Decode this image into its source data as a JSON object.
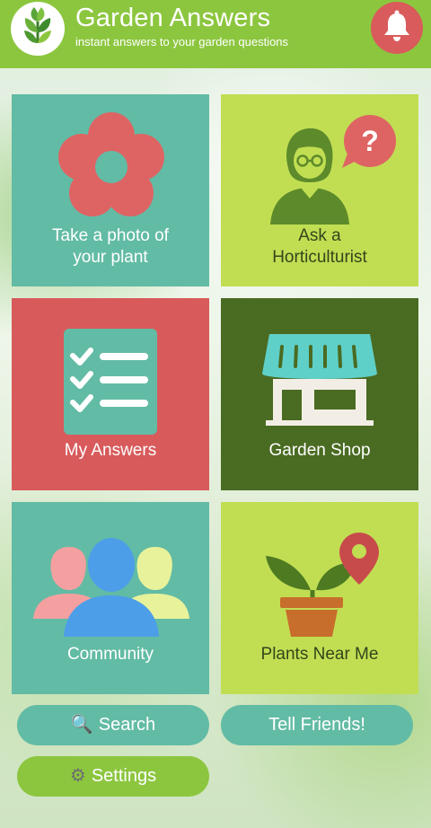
{
  "header": {
    "title": "Garden Answers",
    "subtitle": "instant answers to your garden questions",
    "logo_icon": "seedling-logo-icon",
    "notification_icon": "bell-icon"
  },
  "tiles": [
    {
      "label": "Take a photo of your plant",
      "lines": [
        "Take a photo of",
        "your plant"
      ],
      "icon": "flower-icon",
      "color": "#62bba5"
    },
    {
      "label": "Ask a Horticulturist",
      "lines": [
        "Ask a",
        "Horticulturist"
      ],
      "icon": "person-question-icon",
      "color": "#c1de53"
    },
    {
      "label": "My Answers",
      "lines": [
        "My Answers"
      ],
      "icon": "checklist-icon",
      "color": "#d85a5b"
    },
    {
      "label": "Garden Shop",
      "lines": [
        "Garden Shop"
      ],
      "icon": "storefront-icon",
      "color": "#4a6b22"
    },
    {
      "label": "Community",
      "lines": [
        "Community"
      ],
      "icon": "people-icon",
      "color": "#62bba5"
    },
    {
      "label": "Plants Near Me",
      "lines": [
        "Plants Near Me"
      ],
      "icon": "plant-location-icon",
      "color": "#c1de53"
    }
  ],
  "buttons": {
    "search": {
      "label": "Search",
      "glyph": "🔍",
      "icon": "magnifier-icon"
    },
    "tell_friends": {
      "label": "Tell Friends!"
    },
    "settings": {
      "label": "Settings",
      "glyph": "⚙",
      "icon": "gear-icon"
    }
  },
  "colors": {
    "header": "#8cc63f",
    "bell": "#d95b5b",
    "teal": "#62bba5",
    "lime": "#c1de53",
    "red": "#d85a5b",
    "olive": "#4a6b22",
    "settings_button": "#8cc63f"
  }
}
